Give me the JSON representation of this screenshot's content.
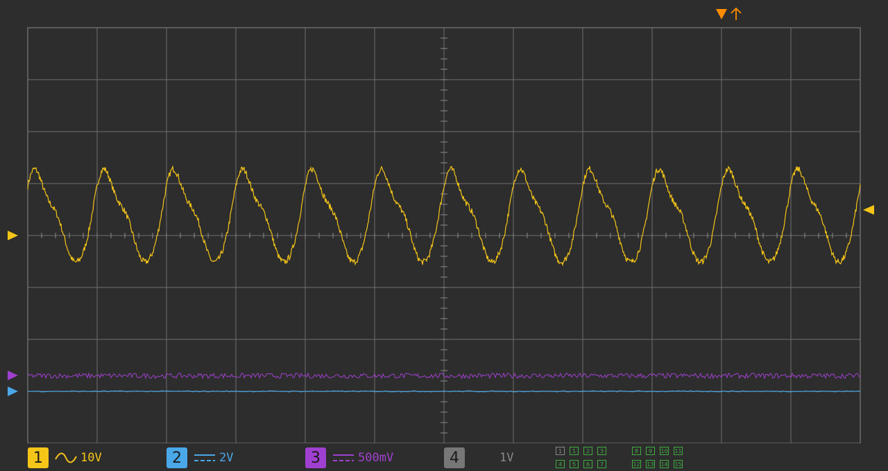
{
  "channels": [
    {
      "num": "1",
      "coupling": "ac",
      "scale": "10V",
      "color": "#f5c518"
    },
    {
      "num": "2",
      "coupling": "dc",
      "scale": "2V",
      "color": "#4aa8e8"
    },
    {
      "num": "3",
      "coupling": "dc",
      "scale": "500mV",
      "color": "#a040d0"
    },
    {
      "num": "4",
      "coupling": "off",
      "scale": "1V",
      "color": "#888888"
    }
  ],
  "digital_channels": {
    "group_a": [
      "1",
      "1",
      "2",
      "3",
      "4",
      "5",
      "6",
      "7"
    ],
    "group_b": [
      "8",
      "9",
      "10",
      "11",
      "12",
      "13",
      "14",
      "15"
    ],
    "off_index": 0
  },
  "trigger_color": "#ff8c00",
  "icons": {
    "trigger": "trigger-position-marker-icon",
    "trigger_edge": "rising-edge-arrow-icon",
    "ch1_level": "trigger-level-marker-icon"
  },
  "chart_data": {
    "type": "line",
    "title": "",
    "xlabel": "",
    "ylabel": "",
    "grid": true,
    "divisions": {
      "x": 12,
      "y": 8
    },
    "series": [
      {
        "name": "1",
        "shape": "distorted sine with noise",
        "amplitude_div": 1.0,
        "offset_div": 0.35,
        "cycles": 12,
        "noise_div": 0.06
      },
      {
        "name": "2",
        "shape": "flat",
        "level_div": -3.0,
        "noise_div": 0.01
      },
      {
        "name": "3",
        "shape": "flat noisy",
        "level_div": -2.7,
        "noise_div": 0.05
      }
    ]
  }
}
